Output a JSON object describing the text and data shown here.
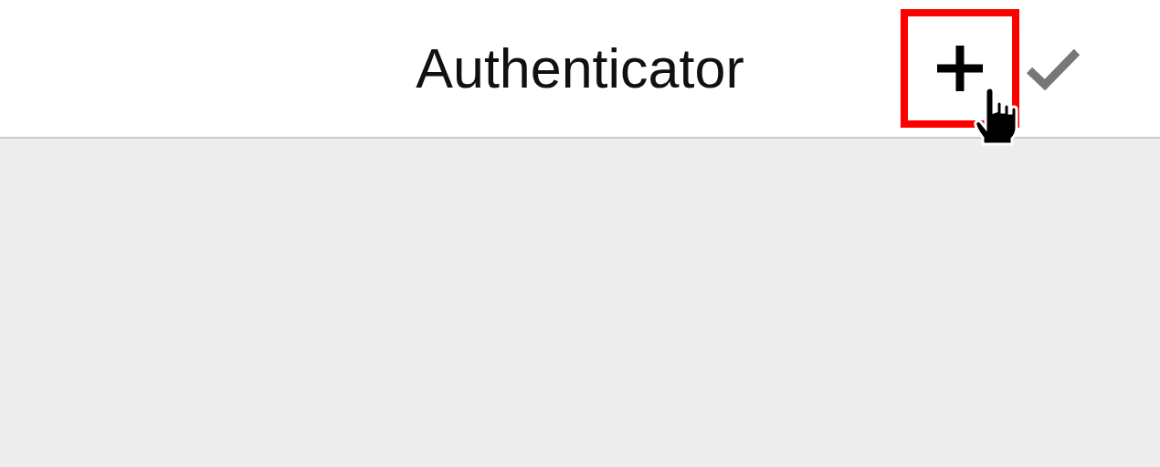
{
  "header": {
    "title": "Authenticator",
    "actions": [
      {
        "kind": "add",
        "highlighted": true
      },
      {
        "kind": "done",
        "highlighted": false
      }
    ]
  }
}
